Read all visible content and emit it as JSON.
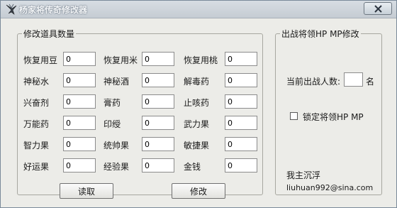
{
  "window": {
    "title": "杨家将传奇修改器",
    "close_label": "close"
  },
  "left_group": {
    "legend": "修改道具数量",
    "rows": [
      [
        {
          "label": "恢复用豆",
          "value": "0"
        },
        {
          "label": "恢复用米",
          "value": "0"
        },
        {
          "label": "恢复用桃",
          "value": "0"
        }
      ],
      [
        {
          "label": "神秘水",
          "value": "0"
        },
        {
          "label": "神秘酒",
          "value": "0"
        },
        {
          "label": "解毒药",
          "value": "0"
        }
      ],
      [
        {
          "label": "兴奋剂",
          "value": "0"
        },
        {
          "label": "膏药",
          "value": "0"
        },
        {
          "label": "止咳药",
          "value": "0"
        }
      ],
      [
        {
          "label": "万能药",
          "value": "0"
        },
        {
          "label": "印绶",
          "value": "0"
        },
        {
          "label": "武力果",
          "value": "0"
        }
      ],
      [
        {
          "label": "智力果",
          "value": "0"
        },
        {
          "label": "统帅果",
          "value": "0"
        },
        {
          "label": "敏捷果",
          "value": "0"
        }
      ],
      [
        {
          "label": "好运果",
          "value": "0"
        },
        {
          "label": "经验果",
          "value": "0"
        },
        {
          "label": "金钱",
          "value": "0"
        }
      ]
    ],
    "read_button": "读取",
    "modify_button": "修改"
  },
  "right_group": {
    "legend": "出战将领HP MP修改",
    "count_label": "当前出战人数:",
    "count_value": "",
    "count_unit": "名",
    "lock_label": "锁定将领HP MP",
    "lock_checked": false,
    "author": "我主沉浮",
    "email": "liuhuan992@sina.com"
  }
}
